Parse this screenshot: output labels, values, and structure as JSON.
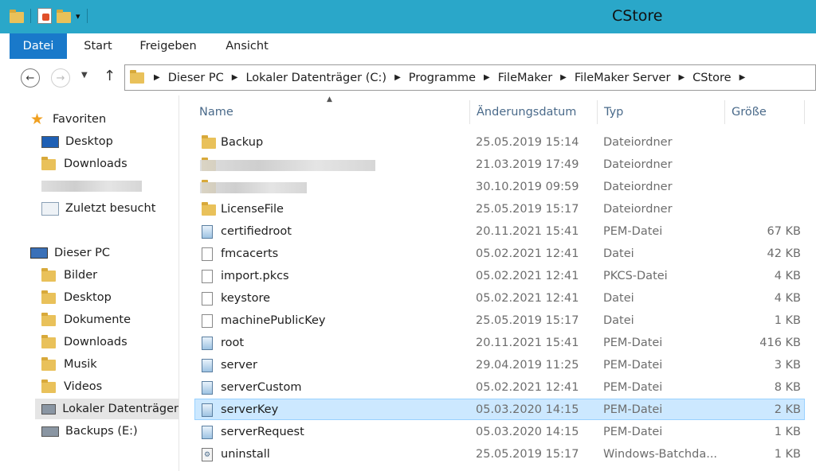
{
  "window": {
    "title": "CStore"
  },
  "ribbon": {
    "tabs": [
      "Datei",
      "Start",
      "Freigeben",
      "Ansicht"
    ]
  },
  "address": {
    "crumbs": [
      "Dieser PC",
      "Lokaler Datenträger (C:)",
      "Programme",
      "FileMaker",
      "FileMaker Server",
      "CStore"
    ]
  },
  "nav": {
    "favorites": {
      "label": "Favoriten",
      "items": [
        "Desktop",
        "Downloads",
        "",
        "Zuletzt besucht"
      ]
    },
    "thispc": {
      "label": "Dieser PC",
      "items": [
        "Bilder",
        "Desktop",
        "Dokumente",
        "Downloads",
        "Musik",
        "Videos",
        "Lokaler Datenträger",
        "Backups (E:)"
      ]
    }
  },
  "columns": {
    "name": "Name",
    "date": "Änderungsdatum",
    "type": "Typ",
    "size": "Größe"
  },
  "files": [
    {
      "name": "Backup",
      "date": "25.05.2019 15:14",
      "type": "Dateiordner",
      "size": "",
      "icon": "folder-icon"
    },
    {
      "name": "",
      "date": "21.03.2019 17:49",
      "type": "Dateiordner",
      "size": "",
      "icon": "folder-icon"
    },
    {
      "name": "",
      "date": "30.10.2019 09:59",
      "type": "Dateiordner",
      "size": "",
      "icon": "folder-icon"
    },
    {
      "name": "LicenseFile",
      "date": "25.05.2019 15:17",
      "type": "Dateiordner",
      "size": "",
      "icon": "folder-icon"
    },
    {
      "name": "certifiedroot",
      "date": "20.11.2021 15:41",
      "type": "PEM-Datei",
      "size": "67 KB",
      "icon": "certificate-file-icon"
    },
    {
      "name": "fmcacerts",
      "date": "05.02.2021 12:41",
      "type": "Datei",
      "size": "42 KB",
      "icon": "file-icon"
    },
    {
      "name": "import.pkcs",
      "date": "05.02.2021 12:41",
      "type": "PKCS-Datei",
      "size": "4 KB",
      "icon": "file-icon"
    },
    {
      "name": "keystore",
      "date": "05.02.2021 12:41",
      "type": "Datei",
      "size": "4 KB",
      "icon": "file-icon"
    },
    {
      "name": "machinePublicKey",
      "date": "25.05.2019 15:17",
      "type": "Datei",
      "size": "1 KB",
      "icon": "file-icon"
    },
    {
      "name": "root",
      "date": "20.11.2021 15:41",
      "type": "PEM-Datei",
      "size": "416 KB",
      "icon": "certificate-file-icon"
    },
    {
      "name": "server",
      "date": "29.04.2019 11:25",
      "type": "PEM-Datei",
      "size": "3 KB",
      "icon": "certificate-file-icon"
    },
    {
      "name": "serverCustom",
      "date": "05.02.2021 12:41",
      "type": "PEM-Datei",
      "size": "8 KB",
      "icon": "certificate-file-icon"
    },
    {
      "name": "serverKey",
      "date": "05.03.2020 14:15",
      "type": "PEM-Datei",
      "size": "2 KB",
      "icon": "certificate-file-icon",
      "selected": true
    },
    {
      "name": "serverRequest",
      "date": "05.03.2020 14:15",
      "type": "PEM-Datei",
      "size": "1 KB",
      "icon": "certificate-file-icon"
    },
    {
      "name": "uninstall",
      "date": "25.05.2019 15:17",
      "type": "Windows-Batchda...",
      "size": "1 KB",
      "icon": "batch-file-icon"
    }
  ]
}
